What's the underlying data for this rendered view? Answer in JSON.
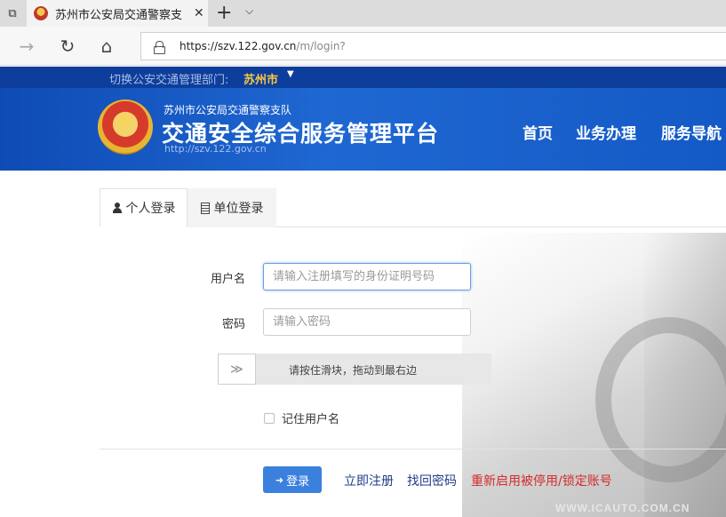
{
  "browser": {
    "tab_title": "苏州市公安局交通警察支",
    "tab_close": "✕",
    "new_tab": "+",
    "tab_menu": "⌵",
    "url_host": "https://szv.122.gov.cn",
    "url_path": "/m/login?"
  },
  "header": {
    "switch_label": "切换公安交通管理部门:",
    "switch_city": "苏州市",
    "subtitle": "苏州市公安局交通警察支队",
    "title": "交通安全综合服务管理平台",
    "site_url": "http://szv.122.gov.cn",
    "nav": [
      "首页",
      "业务办理",
      "服务导航"
    ]
  },
  "login": {
    "tabs": [
      "个人登录",
      "单位登录"
    ],
    "username_label": "用户名",
    "username_placeholder": "请输入注册填写的身份证明号码",
    "password_label": "密码",
    "password_placeholder": "请输入密码",
    "slider_handle": "≫",
    "slider_text": "请按住滑块，拖动到最右边",
    "remember_label": "记住用户名",
    "login_button": "登录",
    "register_link": "立即注册",
    "recover_link": "找回密码",
    "reactivate_link": "重新启用被停用/锁定账号"
  },
  "watermark": "WWW.ICAUTO.COM.CN",
  "colors": {
    "brand_blue": "#1358c4",
    "topbar_blue": "#0d3e9b",
    "button_blue": "#3c80dd",
    "city_gold": "#f6c744",
    "alert_red": "#d42b2b"
  }
}
